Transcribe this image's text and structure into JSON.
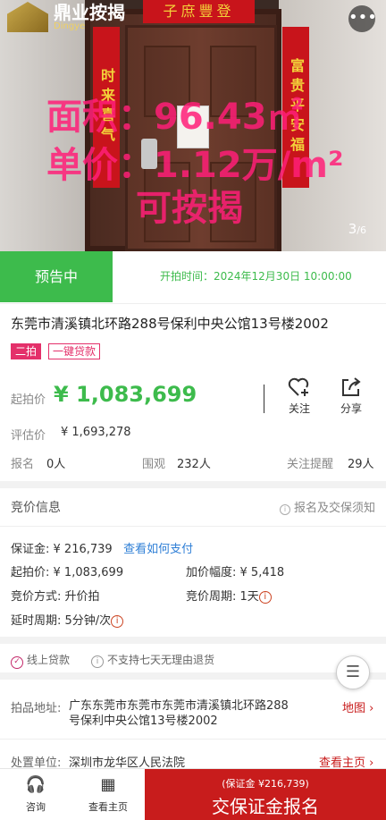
{
  "hero": {
    "logo_text": "鼎业按揭",
    "logo_sub": "Dingye",
    "hengpi": "子庶豐登",
    "couplet_left": "时来喜气",
    "couplet_right": "富贵平安福",
    "overlay": {
      "area": "面积：96.43㎡",
      "unit_price": "单价：1.12万/m²",
      "mortgage": "可按揭"
    },
    "counter_current": "3",
    "counter_total": "/6"
  },
  "status": {
    "state": "预告中",
    "start_time": "开拍时间：2024年12月30日 10:00:00"
  },
  "listing": {
    "title": "东莞市清溪镇北环路288号保利中央公馆13号楼2002",
    "tag_round": "二拍",
    "tag_loan": "一键贷款",
    "start_price_label": "起拍价",
    "start_price": "¥ 1,083,699",
    "follow_label": "关注",
    "share_label": "分享",
    "eval_label": "评估价",
    "eval_value": "¥ 1,693,278",
    "signup_label": "报名",
    "signup_value": "0人",
    "watch_label": "围观",
    "watch_value": "232人",
    "remind_label": "关注提醒",
    "remind_value": "29人"
  },
  "bid_info": {
    "header": "竞价信息",
    "notice": "报名及交保须知",
    "deposit_label": "保证金:",
    "deposit_value": "¥ 216,739",
    "how_pay": "查看如何支付",
    "start_label": "起拍价:",
    "start_value": "¥ 1,083,699",
    "increment_label": "加价幅度:",
    "increment_value": "¥ 5,418",
    "method_label": "竞价方式:",
    "method_value": "升价拍",
    "period_label": "竞价周期:",
    "period_value": "1天",
    "delay_label": "延时周期:",
    "delay_value": "5分钟/次"
  },
  "features": {
    "online_loan": "线上贷款",
    "no_return": "不支持七天无理由退货"
  },
  "location": {
    "label": "拍品地址:",
    "address": "广东东莞市东莞市东莞市清溪镇北环路288号保利中央公馆13号楼2002",
    "map_link": "地图"
  },
  "handler": {
    "label": "处置单位:",
    "value": "深圳市龙华区人民法院",
    "link": "查看主页"
  },
  "bottom": {
    "consult": "咨询",
    "home": "查看主页",
    "cta_sub": "(保证金 ¥216,739)",
    "cta_main": "交保证金报名"
  }
}
